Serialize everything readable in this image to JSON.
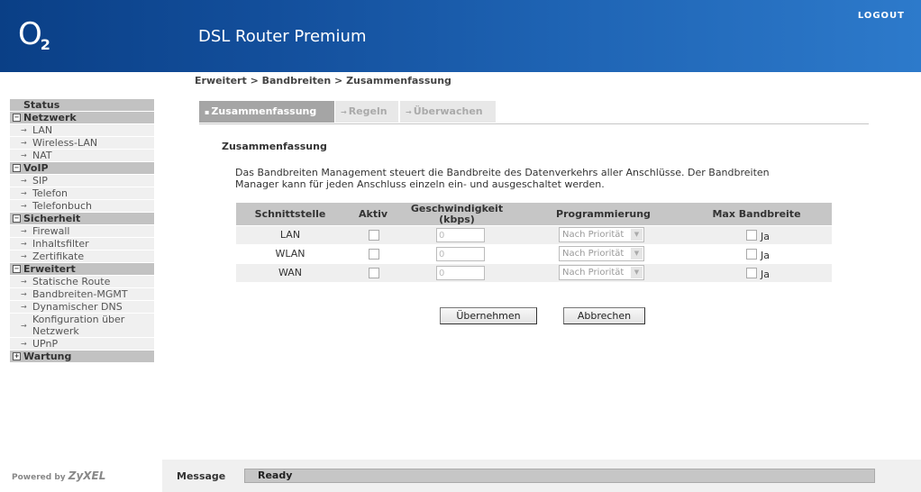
{
  "header": {
    "logo_letter": "O",
    "logo_sub": "2",
    "title": "DSL Router Premium",
    "logout": "LOGOUT"
  },
  "breadcrumb": "Erweitert > Bandbreiten > Zusammenfassung",
  "sidebar": {
    "status": "Status",
    "categories": [
      {
        "label": "Netzwerk",
        "toggle": "−",
        "items": [
          "LAN",
          "Wireless-LAN",
          "NAT"
        ]
      },
      {
        "label": "VoIP",
        "toggle": "−",
        "items": [
          "SIP",
          "Telefon",
          "Telefonbuch"
        ]
      },
      {
        "label": "Sicherheit",
        "toggle": "−",
        "items": [
          "Firewall",
          "Inhaltsfilter",
          "Zertifikate"
        ]
      },
      {
        "label": "Erweitert",
        "toggle": "−",
        "items": [
          "Statische Route",
          "Bandbreiten-MGMT",
          "Dynamischer DNS",
          "Konfiguration über Netzwerk",
          "UPnP"
        ]
      },
      {
        "label": "Wartung",
        "toggle": "+",
        "items": []
      }
    ]
  },
  "tabs": [
    {
      "label": "Zusammenfassung",
      "active": true
    },
    {
      "label": "Regeln",
      "active": false
    },
    {
      "label": "Überwachen",
      "active": false
    }
  ],
  "section_title": "Zusammenfassung",
  "description": "Das Bandbreiten Management steuert die Bandbreite des Datenverkehrs aller Anschlüsse. Der Bandbreiten Manager kann für jeden Anschluss einzeln ein- und ausgeschaltet werden.",
  "table": {
    "headers": {
      "interface": "Schnittstelle",
      "active": "Aktiv",
      "speed": "Geschwindigkeit (kbps)",
      "priority": "Programmierung",
      "max": "Max Bandbreite"
    },
    "rows": [
      {
        "name": "LAN",
        "speed": "0",
        "priority": "Nach Priorität",
        "max_label": "Ja"
      },
      {
        "name": "WLAN",
        "speed": "0",
        "priority": "Nach Priorität",
        "max_label": "Ja"
      },
      {
        "name": "WAN",
        "speed": "0",
        "priority": "Nach Priorität",
        "max_label": "Ja"
      }
    ]
  },
  "buttons": {
    "apply": "Übernehmen",
    "cancel": "Abbrechen"
  },
  "footer": {
    "powered_by": "Powered by",
    "brand": "ZyXEL",
    "message_label": "Message",
    "message": "Ready"
  }
}
